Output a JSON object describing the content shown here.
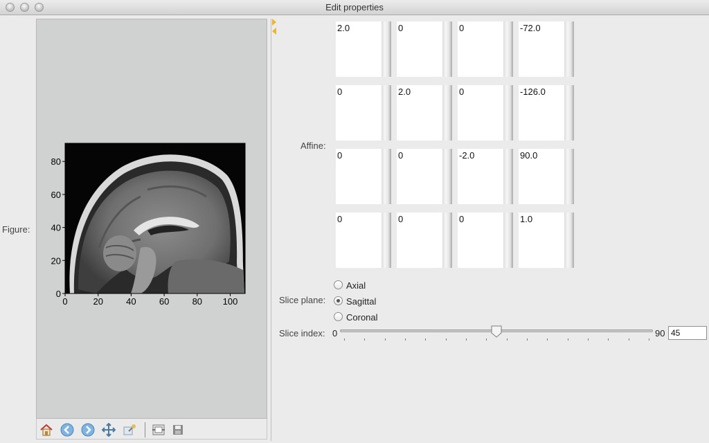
{
  "window": {
    "title": "Edit properties"
  },
  "labels": {
    "figure": "Figure:",
    "affine": "Affine:",
    "slice_plane": "Slice plane:",
    "slice_index": "Slice index:"
  },
  "affine": [
    [
      "2.0",
      "0",
      "0",
      "-72.0"
    ],
    [
      "0",
      "2.0",
      "0",
      "-126.0"
    ],
    [
      "0",
      "0",
      "-2.0",
      "90.0"
    ],
    [
      "0",
      "0",
      "0",
      "1.0"
    ]
  ],
  "slice_plane": {
    "options": [
      "Axial",
      "Sagittal",
      "Coronal"
    ],
    "selected": "Sagittal"
  },
  "slider": {
    "min_label": "0",
    "max_label": "90",
    "min": 0,
    "max": 90,
    "value": 45,
    "value_text": "45"
  },
  "plot": {
    "x_ticks": [
      "0",
      "20",
      "40",
      "60",
      "80",
      "100"
    ],
    "y_ticks": [
      "0",
      "20",
      "40",
      "60",
      "80"
    ]
  },
  "toolbar_icons": [
    "home-icon",
    "back-icon",
    "forward-icon",
    "pan-icon",
    "zoom-icon",
    "subplots-icon",
    "save-icon"
  ]
}
